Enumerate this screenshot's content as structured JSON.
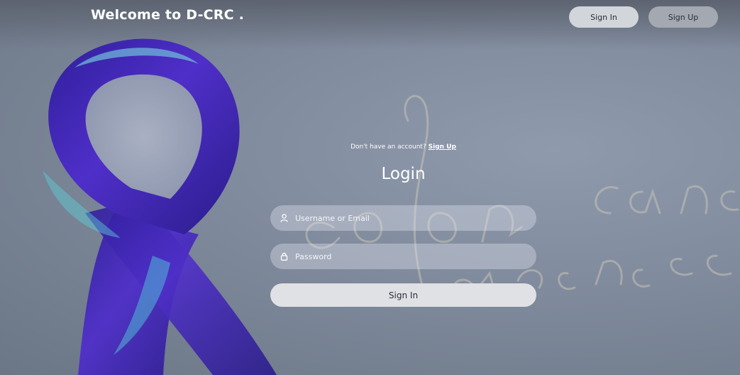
{
  "header": {
    "title": "Welcome to D-CRC .",
    "signin_label": "Sign In",
    "signup_label": "Sign Up"
  },
  "form": {
    "account_prompt": "Don't have an account?",
    "signup_link": "Sign Up",
    "title": "Login",
    "username_placeholder": "Username or Email",
    "password_placeholder": "Password",
    "submit_label": "Sign In"
  },
  "icons": {
    "username": "user-icon",
    "password": "lock-icon"
  },
  "colors": {
    "ribbon": "#4a2bbf",
    "ribbon_highlight": "#3aa0c8",
    "background": "#7d8796"
  }
}
